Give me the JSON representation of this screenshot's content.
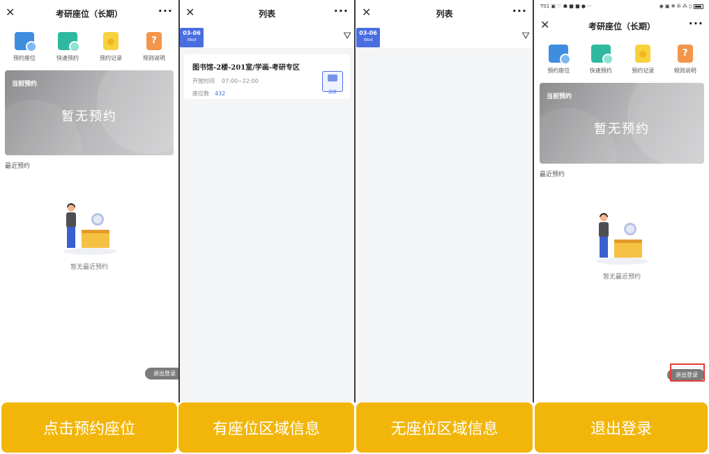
{
  "panels": [
    {
      "title": "考研座位（长期）",
      "icons": [
        {
          "label": "预约座位",
          "icon": "seat-booking-icon"
        },
        {
          "label": "快速预约",
          "icon": "quick-booking-icon"
        },
        {
          "label": "预约记录",
          "icon": "booking-record-icon"
        },
        {
          "label": "规则说明",
          "icon": "rules-icon"
        }
      ],
      "current_label": "当前预约",
      "current_empty": "暂无预约",
      "recent_title": "最近预约",
      "recent_empty": "暂无最近预约",
      "logout": "退出登录"
    },
    {
      "title": "列表",
      "date": {
        "day": "03-06",
        "weekday": "Wed"
      },
      "area": {
        "name": "图书馆-2楼-201室/学画-考研专区",
        "time_label": "开放时间",
        "time_value": "07:00~22:00",
        "seats_label": "座位数",
        "seats_value": "432",
        "pick_label": "选座"
      }
    },
    {
      "title": "列表",
      "date": {
        "day": "03-06",
        "weekday": "Wed"
      }
    },
    {
      "status": {
        "left": "T01 ▣ ♡ ☗ ■ ■ ● ···",
        "right": "◉ ▣ ✻ ✇ ⁂ ▯"
      },
      "title": "考研座位（长期）",
      "icons": [
        {
          "label": "预约座位",
          "icon": "seat-booking-icon"
        },
        {
          "label": "快速预约",
          "icon": "quick-booking-icon"
        },
        {
          "label": "预约记录",
          "icon": "booking-record-icon"
        },
        {
          "label": "规则说明",
          "icon": "rules-icon"
        }
      ],
      "current_label": "当前预约",
      "current_empty": "暂无预约",
      "recent_title": "最近预约",
      "recent_empty": "暂无最近预约",
      "logout": "退出登录"
    }
  ],
  "captions": [
    "点击预约座位",
    "有座位区域信息",
    "无座位区域信息",
    "退出登录"
  ],
  "colors": {
    "caption_bg": "#f2b60a",
    "accent": "#4a6ee0",
    "highlight": "#e53935"
  }
}
